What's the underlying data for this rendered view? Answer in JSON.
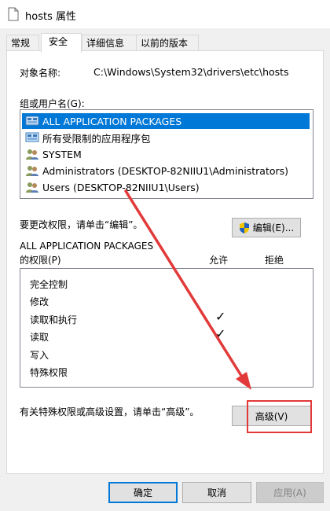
{
  "window": {
    "title": "hosts 属性"
  },
  "tabs": [
    {
      "label": "常规"
    },
    {
      "label": "安全"
    },
    {
      "label": "详细信息"
    },
    {
      "label": "以前的版本"
    }
  ],
  "security": {
    "object_name_label": "对象名称:",
    "object_name_value": "C:\\Windows\\System32\\drivers\\etc\\hosts",
    "group_label": "组或用户名(G):",
    "users": [
      {
        "name": "ALL APPLICATION PACKAGES",
        "icon": "app-package-icon",
        "selected": true
      },
      {
        "name": "所有受限制的应用程序包",
        "icon": "app-package-icon",
        "selected": false
      },
      {
        "name": "SYSTEM",
        "icon": "user-group-icon",
        "selected": false
      },
      {
        "name": "Administrators (DESKTOP-82NIIU1\\Administrators)",
        "icon": "user-group-icon",
        "selected": false
      },
      {
        "name": "Users (DESKTOP-82NIIU1\\Users)",
        "icon": "user-group-icon",
        "selected": false
      }
    ],
    "edit_hint": "要更改权限，请单击“编辑”。",
    "edit_button": "编辑(E)...",
    "perm_for_line1": "ALL APPLICATION PACKAGES",
    "perm_for_line2": "的权限(P)",
    "allow_header": "允许",
    "deny_header": "拒绝",
    "permissions": [
      {
        "name": "完全控制",
        "allow": "",
        "deny": ""
      },
      {
        "name": "修改",
        "allow": "",
        "deny": ""
      },
      {
        "name": "读取和执行",
        "allow": "✓",
        "deny": ""
      },
      {
        "name": "读取",
        "allow": "✓",
        "deny": ""
      },
      {
        "name": "写入",
        "allow": "",
        "deny": ""
      },
      {
        "name": "特殊权限",
        "allow": "",
        "deny": ""
      }
    ],
    "advanced_hint": "有关特殊权限或高级设置，请单击“高级”。",
    "advanced_button": "高级(V)"
  },
  "footer": {
    "ok": "确定",
    "cancel": "取消",
    "apply": "应用(A)"
  },
  "colors": {
    "selection": "#0078d7",
    "annotation": "#e23a3a"
  }
}
